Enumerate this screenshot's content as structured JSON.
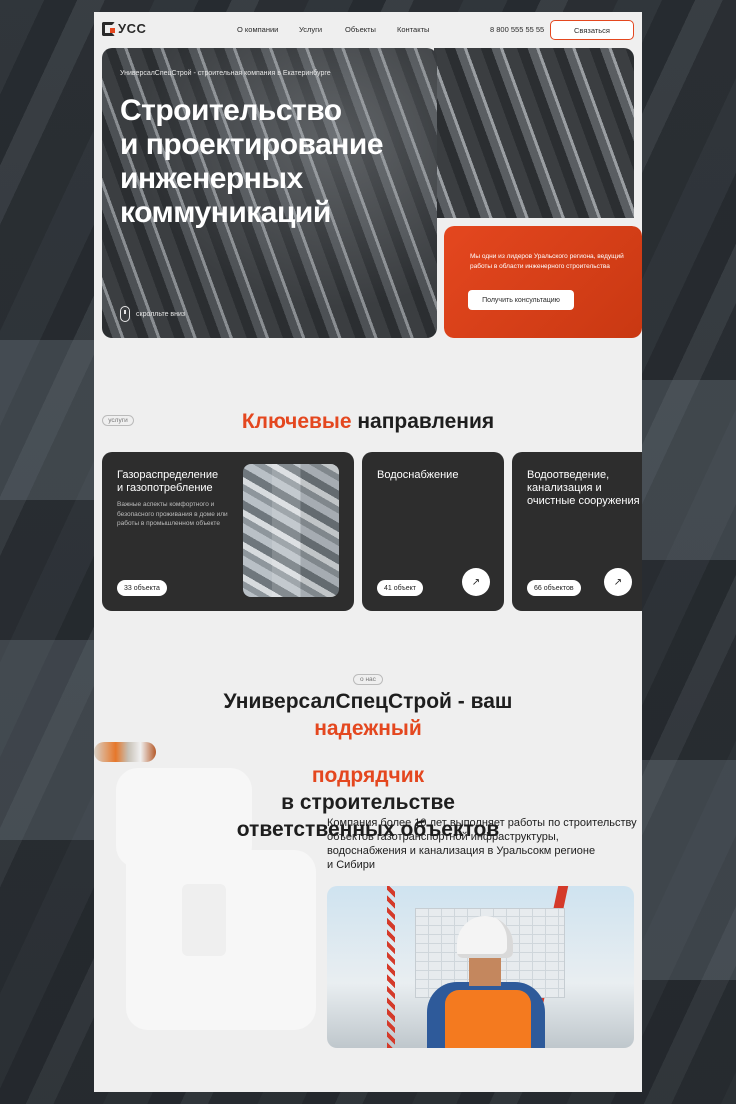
{
  "header": {
    "logo": "УСС",
    "nav": [
      "О компании",
      "Услуги",
      "Объекты",
      "Контакты"
    ],
    "phone": "8 800 555 55 55",
    "cta": "Связаться"
  },
  "hero": {
    "subtitle": "УниверсалСпецСтрой - строительная компания в Екатеринбурге",
    "title_lines": [
      "Строительство",
      "и проектирование",
      "инженерных",
      "коммуникаций"
    ],
    "scroll_label": "скролльте вниз",
    "card_text": "Мы одни из лидеров Уральского региона, ведущий работы в области инженерного строительства",
    "card_button": "Получить консультацию"
  },
  "directions": {
    "tag": "услуги",
    "title_accent": "Ключевые",
    "title_rest": "направления",
    "cards": [
      {
        "title_lines": [
          "Газораспределение",
          "и газопотребление"
        ],
        "desc": "Важные аспекты комфортного и безопасного проживания в доме или работы в промышленном объекте",
        "count": "33 объекта"
      },
      {
        "title_lines": [
          "Водоснабжение"
        ],
        "count": "41 объект",
        "arrow": "↗"
      },
      {
        "title_lines": [
          "Водоотведение,",
          "канализация и",
          "очистные сооружения"
        ],
        "count": "66 объектов",
        "arrow": "↗"
      }
    ]
  },
  "about": {
    "tag": "о нас",
    "line1": "УниверсалСпецСтрой - ваш",
    "line2_a": "надежный",
    "line2_b": "подрядчик",
    "line3": "в строительстве",
    "line4": "ответственных объектов",
    "text_lines": [
      "Компания более 10 лет выполняет работы по строительству",
      "объектов газотранспортной инфраструктуры,",
      "водоснабжения и канализация в Уральсокм регионе",
      "и Сибири"
    ]
  },
  "colors": {
    "accent": "#e4471f",
    "card_dark": "#2d2d2d",
    "page_bg": "#efefef"
  }
}
